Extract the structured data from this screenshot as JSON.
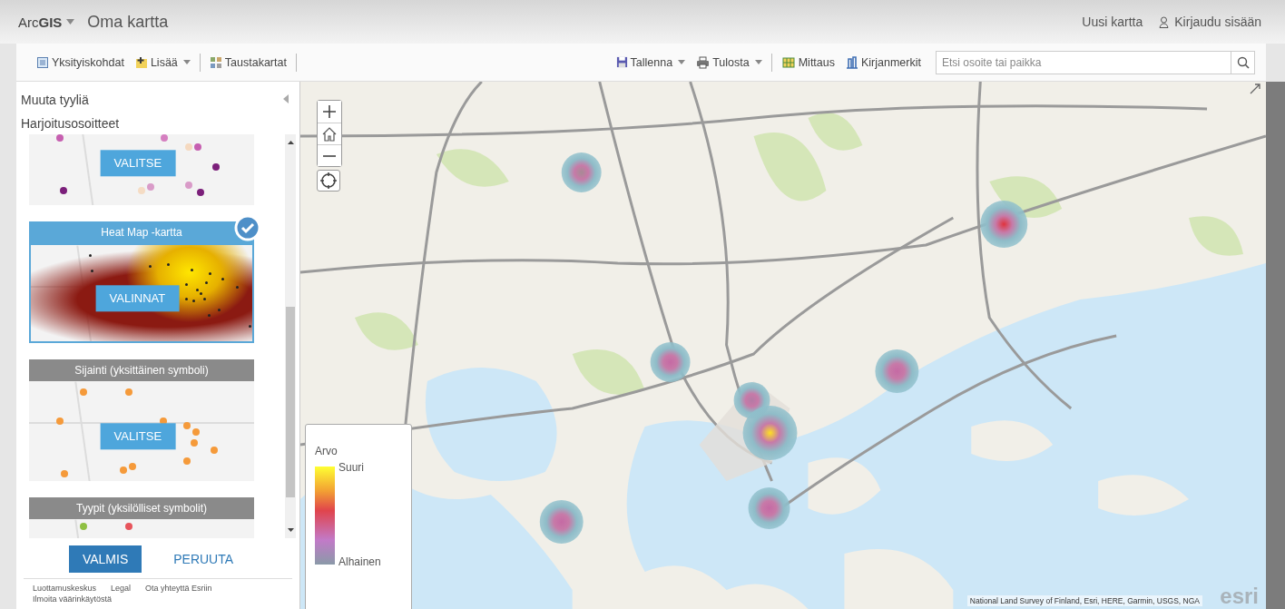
{
  "header": {
    "logo": "Arc**GIS**",
    "title": "Oma kartta",
    "links": [
      "Uusi kartta",
      "Kirjaudu sisään"
    ]
  },
  "toolbar": {
    "left": [
      {
        "kind": "details",
        "label": "Yksityiskohdat",
        "dropdown": false
      },
      {
        "kind": "add",
        "label": "Lisää",
        "dropdown": true
      },
      {
        "kind": "basemap",
        "label": "Taustakartat",
        "dropdown": false
      }
    ],
    "right": [
      {
        "kind": "save",
        "label": "Tallenna",
        "dropdown": true
      },
      {
        "kind": "print",
        "label": "Tulosta",
        "dropdown": true
      },
      {
        "kind": "measure",
        "label": "Mittaus",
        "dropdown": false
      },
      {
        "kind": "bookmarks",
        "label": "Kirjanmerkit",
        "dropdown": false
      }
    ],
    "search": {
      "placeholder": "Etsi osoite tai paikka"
    }
  },
  "panel": {
    "title": "Muuta tyyliä",
    "layer": "Harjoitusosoitteet",
    "styles": [
      {
        "kind": "counts",
        "button": "VALITSE",
        "selected": false
      },
      {
        "kind": "heatmap",
        "title": "Heat Map -kartta",
        "button": "VALINNAT",
        "selected": true
      },
      {
        "kind": "location",
        "title": "Sijainti (yksittäinen symboli)",
        "button": "VALITSE",
        "selected": false
      },
      {
        "kind": "types",
        "title": "Tyypit (yksilölliset symbolit)",
        "selected": false
      }
    ],
    "actions": [
      "VALMIS",
      "PERUUTA"
    ],
    "footer_links": [
      "Luottamuskeskus",
      "Legal",
      "Ota yhteyttä Esriin",
      "Ilmoita väärinkäytöstä"
    ]
  },
  "legend": {
    "title": "Arvo",
    "high": "Suuri",
    "low": "Alhainen"
  },
  "attribution": "National Land Survey of Finland, Esri, HERE, Garmin, USGS, NGA",
  "esri_logo": "esri"
}
